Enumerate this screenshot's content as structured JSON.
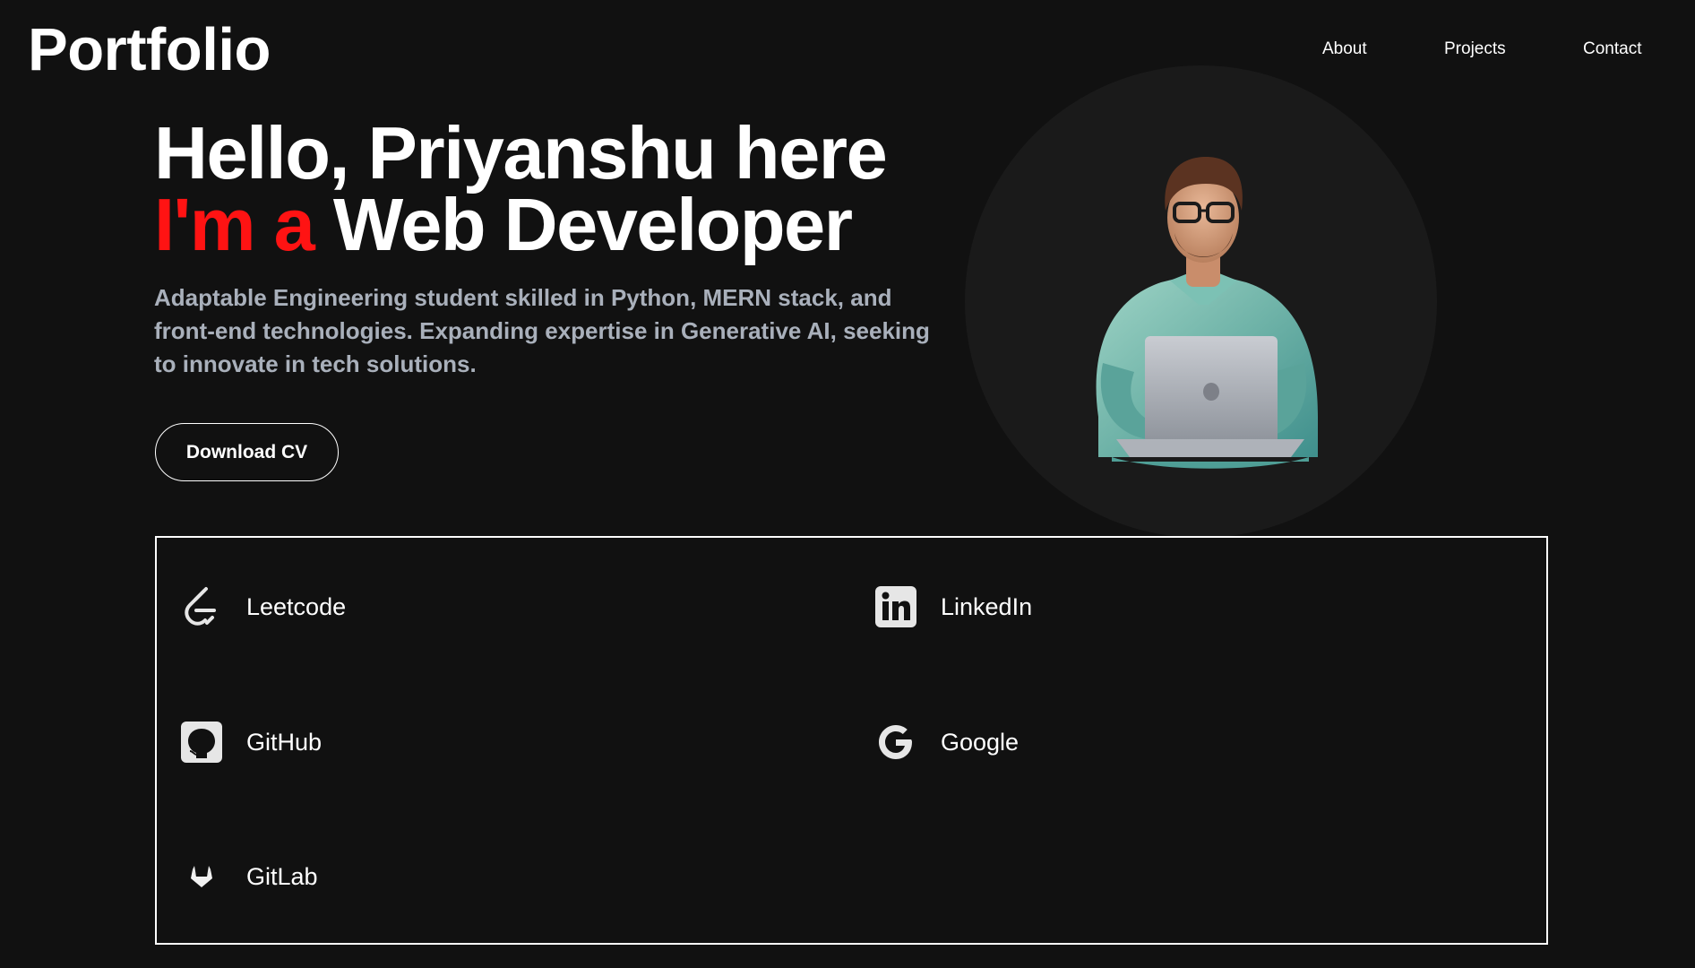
{
  "header": {
    "brand": "Portfolio",
    "nav": [
      {
        "label": "About"
      },
      {
        "label": "Projects"
      },
      {
        "label": "Contact"
      }
    ]
  },
  "hero": {
    "greeting": "Hello, Priyanshu here",
    "intro_prefix": "I'm a",
    "role": "Web Developer",
    "description": "Adaptable Engineering student skilled in Python, MERN stack, and front-end technologies. Expanding expertise in Generative AI, seeking to innovate in tech solutions.",
    "cta_label": "Download CV"
  },
  "social": [
    {
      "label": "Leetcode",
      "icon": "leetcode-icon"
    },
    {
      "label": "LinkedIn",
      "icon": "linkedin-icon"
    },
    {
      "label": "GitHub",
      "icon": "github-icon"
    },
    {
      "label": "Google",
      "icon": "google-icon"
    },
    {
      "label": "GitLab",
      "icon": "gitlab-icon"
    }
  ],
  "colors": {
    "background": "#111111",
    "accent": "#ff1313",
    "muted_text": "#a9b0bb",
    "portrait_circle": "#1a1a1a"
  }
}
